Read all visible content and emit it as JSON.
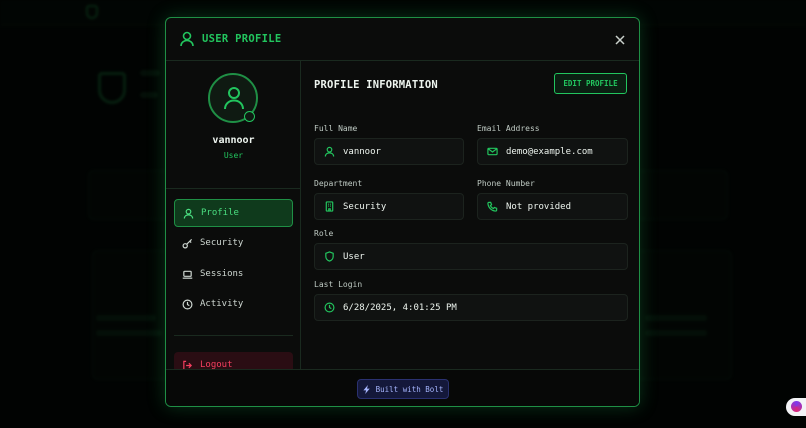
{
  "modal": {
    "title": "USER PROFILE"
  },
  "user": {
    "name": "vannoor",
    "role": "User"
  },
  "nav": {
    "items": [
      {
        "label": "Profile",
        "icon": "user-icon",
        "active": true
      },
      {
        "label": "Security",
        "icon": "key-icon",
        "active": false
      },
      {
        "label": "Sessions",
        "icon": "laptop-icon",
        "active": false
      },
      {
        "label": "Activity",
        "icon": "clock-icon",
        "active": false
      }
    ],
    "logout_label": "Logout"
  },
  "profile": {
    "section_title": "PROFILE INFORMATION",
    "edit_label": "EDIT PROFILE",
    "fields": {
      "full_name": {
        "label": "Full Name",
        "value": "vannoor",
        "icon": "user-icon"
      },
      "email": {
        "label": "Email Address",
        "value": "demo@example.com",
        "icon": "mail-icon"
      },
      "department": {
        "label": "Department",
        "value": "Security",
        "icon": "building-icon"
      },
      "phone": {
        "label": "Phone Number",
        "value": "Not provided",
        "icon": "phone-icon"
      },
      "role": {
        "label": "Role",
        "value": "User",
        "icon": "shield-icon"
      },
      "last_login": {
        "label": "Last Login",
        "value": "6/28/2025, 4:01:25 PM",
        "icon": "clock-icon"
      }
    }
  },
  "footer": {
    "badge_label": "Built with Bolt"
  },
  "colors": {
    "accent": "#22c55e",
    "danger": "#f43f5e",
    "background": "#0b0c0b"
  }
}
